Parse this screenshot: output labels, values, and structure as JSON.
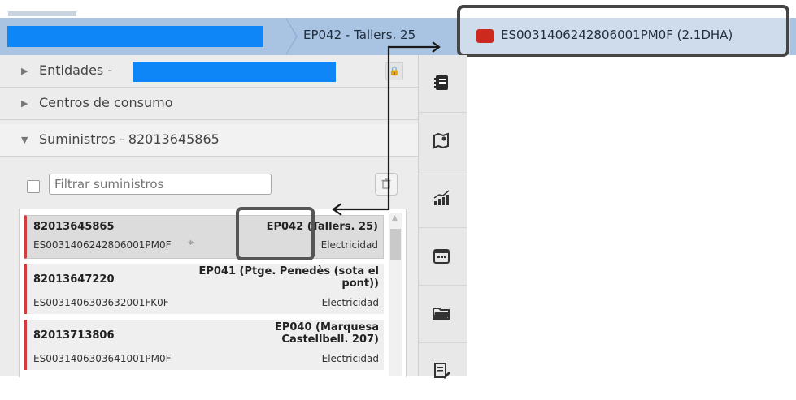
{
  "breadcrumb": {
    "segment1": "EP042 - Tallers. 25",
    "segment2": "ES0031406242806001PM0F (2.1DHA)"
  },
  "panel": {
    "entidades_label": "Entidades -",
    "centros_label": "Centros de consumo",
    "suministros_label": "Suministros - 82013645865",
    "filter_placeholder": "Filtrar suministros"
  },
  "supplies": [
    {
      "id": "82013645865",
      "name": "EP042 (Tallers. 25)",
      "cups": "ES0031406242806001PM0F",
      "type": "Electricidad"
    },
    {
      "id": "82013647220",
      "name": "EP041 (Ptge. Penedès (sota el pont))",
      "cups": "ES0031406303632001FK0F",
      "type": "Electricidad"
    },
    {
      "id": "82013713806",
      "name": "EP040 (Marquesa Castellbell. 207)",
      "cups": "ES0031406303641001PM0F",
      "type": "Electricidad"
    }
  ],
  "colors": {
    "breadcrumb_bg": "#a9c3e2",
    "redacted": "#0e86f7",
    "status_red": "#cc2a1d",
    "item_accent": "#d43b3b"
  },
  "icons": [
    "notebook-icon",
    "map-icon",
    "chart-icon",
    "calendar-icon",
    "folder-icon",
    "edit-list-icon",
    "trash-icon",
    "lock-icon",
    "crosshair-icon"
  ]
}
